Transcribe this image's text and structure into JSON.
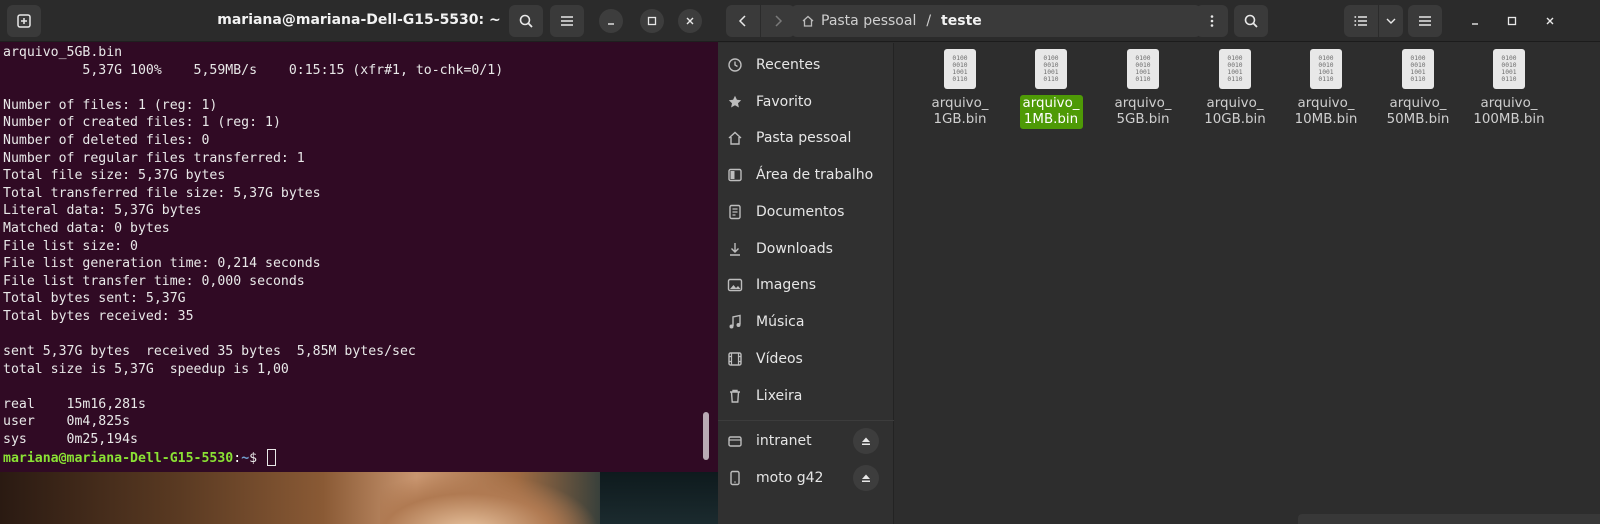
{
  "terminal": {
    "title": "mariana@mariana-Dell-G15-5530: ~",
    "lines": [
      "arquivo_5GB.bin",
      "          5,37G 100%    5,59MB/s    0:15:15 (xfr#1, to-chk=0/1)",
      "",
      "Number of files: 1 (reg: 1)",
      "Number of created files: 1 (reg: 1)",
      "Number of deleted files: 0",
      "Number of regular files transferred: 1",
      "Total file size: 5,37G bytes",
      "Total transferred file size: 5,37G bytes",
      "Literal data: 5,37G bytes",
      "Matched data: 0 bytes",
      "File list size: 0",
      "File list generation time: 0,214 seconds",
      "File list transfer time: 0,000 seconds",
      "Total bytes sent: 5,37G",
      "Total bytes received: 35",
      "",
      "sent 5,37G bytes  received 35 bytes  5,85M bytes/sec",
      "total size is 5,37G  speedup is 1,00",
      "",
      "real    15m16,281s",
      "user    0m4,825s",
      "sys     0m25,194s"
    ],
    "prompt": {
      "user_host": "mariana@mariana-Dell-G15-5530",
      "separator": ":",
      "path": "~",
      "symbol": "$ "
    },
    "colors": {
      "background": "#300a24",
      "prompt_user": "#8ae234",
      "prompt_path": "#729fcf"
    }
  },
  "files": {
    "pathbar": {
      "home_label": "Pasta pessoal",
      "separator": "/",
      "current": "teste"
    },
    "sidebar": {
      "items": [
        {
          "label": "Recentes",
          "icon": "clock-icon"
        },
        {
          "label": "Favorito",
          "icon": "star-icon"
        },
        {
          "label": "Pasta pessoal",
          "icon": "home-icon"
        },
        {
          "label": "Área de trabalho",
          "icon": "desktop-icon"
        },
        {
          "label": "Documentos",
          "icon": "document-icon"
        },
        {
          "label": "Downloads",
          "icon": "download-icon"
        },
        {
          "label": "Imagens",
          "icon": "image-icon"
        },
        {
          "label": "Música",
          "icon": "music-icon"
        },
        {
          "label": "Vídeos",
          "icon": "video-icon"
        },
        {
          "label": "Lixeira",
          "icon": "trash-icon"
        }
      ],
      "devices": [
        {
          "label": "intranet",
          "icon": "drive-icon"
        },
        {
          "label": "moto g42",
          "icon": "phone-icon"
        }
      ]
    },
    "items": [
      {
        "name": "arquivo_\n1GB.bin",
        "selected": false
      },
      {
        "name": "arquivo_\n1MB.bin",
        "selected": true
      },
      {
        "name": "arquivo_\n5GB.bin",
        "selected": false
      },
      {
        "name": "arquivo_\n10GB.bin",
        "selected": false
      },
      {
        "name": "arquivo_\n10MB.bin",
        "selected": false
      },
      {
        "name": "arquivo_\n50MB.bin",
        "selected": false
      },
      {
        "name": "arquivo_\n100MB.bin",
        "selected": false
      }
    ],
    "file_icon_bits": "0100\n0010\n1001\n0110",
    "colors": {
      "selection": "#4e9a06"
    }
  }
}
